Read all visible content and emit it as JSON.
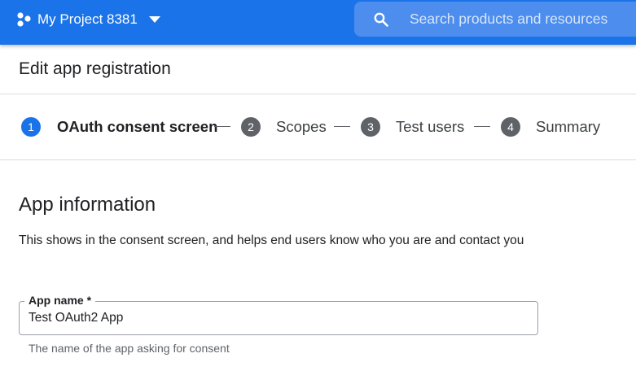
{
  "header": {
    "project_name": "My Project 8381",
    "search_placeholder": "Search products and resources",
    "project_icon": "project-dots-icon",
    "search_icon": "search-icon",
    "brand_color": "#1a73e8"
  },
  "page": {
    "title": "Edit app registration"
  },
  "stepper": {
    "steps": [
      {
        "number": "1",
        "label": "OAuth consent screen",
        "active": true
      },
      {
        "number": "2",
        "label": "Scopes",
        "active": false
      },
      {
        "number": "3",
        "label": "Test users",
        "active": false
      },
      {
        "number": "4",
        "label": "Summary",
        "active": false
      }
    ]
  },
  "app_info": {
    "title": "App information",
    "description": "This shows in the consent screen, and helps end users know who you are and contact you",
    "app_name": {
      "label": "App name *",
      "value": "Test OAuth2 App",
      "hint": "The name of the app asking for consent"
    }
  }
}
